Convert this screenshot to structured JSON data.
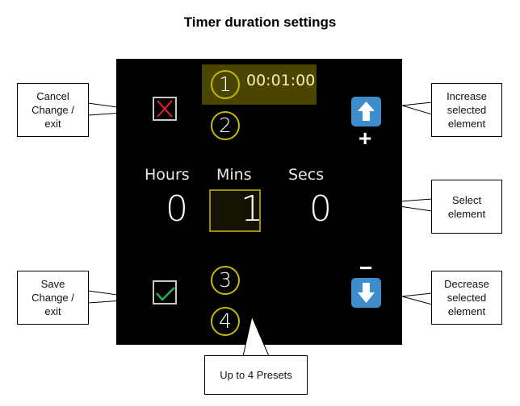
{
  "title": "Timer duration settings",
  "device": {
    "presets": [
      {
        "number": "1",
        "time": "00:01:00",
        "selected": true
      },
      {
        "number": "2"
      },
      {
        "number": "3"
      },
      {
        "number": "4"
      }
    ],
    "columns": [
      {
        "label": "Hours",
        "value": "0"
      },
      {
        "label": "Mins",
        "value": "1",
        "selected": true
      },
      {
        "label": "Secs",
        "value": "0"
      }
    ],
    "increase_sign": "+",
    "decrease_sign": "−",
    "colors": {
      "screen_bg": "#000000",
      "highlight_bg": "#4a4500",
      "ring": "#c8b800",
      "button_blue": "#3d8ccb",
      "cancel_red": "#e8222a",
      "save_green": "#22b04b"
    }
  },
  "callouts": {
    "cancel": "Cancel\nChange /\nexit",
    "save": "Save\nChange /\nexit",
    "increase": "Increase\nselected\nelement",
    "select": "Select\nelement",
    "decrease": "Decrease\nselected\nelement",
    "presets": "Up to 4 Presets"
  }
}
